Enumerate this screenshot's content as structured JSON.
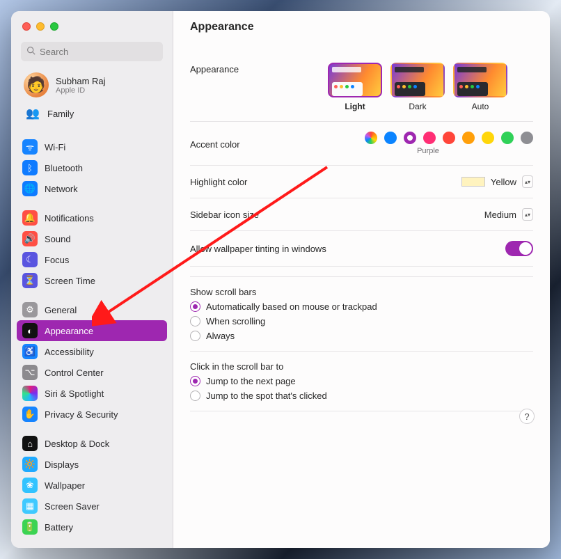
{
  "search": {
    "placeholder": "Search"
  },
  "user": {
    "name": "Subham Raj",
    "sub": "Apple ID"
  },
  "family": {
    "label": "Family"
  },
  "sidebar": {
    "items": [
      {
        "label": "Wi-Fi"
      },
      {
        "label": "Bluetooth"
      },
      {
        "label": "Network"
      },
      {
        "label": "Notifications"
      },
      {
        "label": "Sound"
      },
      {
        "label": "Focus"
      },
      {
        "label": "Screen Time"
      },
      {
        "label": "General"
      },
      {
        "label": "Appearance"
      },
      {
        "label": "Accessibility"
      },
      {
        "label": "Control Center"
      },
      {
        "label": "Siri & Spotlight"
      },
      {
        "label": "Privacy & Security"
      },
      {
        "label": "Desktop & Dock"
      },
      {
        "label": "Displays"
      },
      {
        "label": "Wallpaper"
      },
      {
        "label": "Screen Saver"
      },
      {
        "label": "Battery"
      }
    ]
  },
  "page": {
    "title": "Appearance"
  },
  "appearance": {
    "label": "Appearance",
    "options": [
      {
        "label": "Light",
        "selected": true,
        "dark": false
      },
      {
        "label": "Dark",
        "selected": false,
        "dark": true
      },
      {
        "label": "Auto",
        "selected": false,
        "dark": true
      }
    ]
  },
  "accent": {
    "label": "Accent color",
    "selected_label": "Purple",
    "colors": [
      "multicolor",
      "#0b84ff",
      "#9e27b0",
      "#ff2e74",
      "#ff453a",
      "#ff9f0a",
      "#ffd60a",
      "#30d158",
      "#8e8e93"
    ],
    "selected_index": 2
  },
  "highlight": {
    "label": "Highlight color",
    "value": "Yellow",
    "swatch": "#fff3bf"
  },
  "sidebar_size": {
    "label": "Sidebar icon size",
    "value": "Medium"
  },
  "tinting": {
    "label": "Allow wallpaper tinting in windows",
    "on": true
  },
  "scrollbars": {
    "heading": "Show scroll bars",
    "options": [
      "Automatically based on mouse or trackpad",
      "When scrolling",
      "Always"
    ],
    "selected": 0
  },
  "click": {
    "heading": "Click in the scroll bar to",
    "options": [
      "Jump to the next page",
      "Jump to the spot that's clicked"
    ],
    "selected": 0
  },
  "icons": {
    "wifi": "ᯤ",
    "bt": "ᛒ",
    "net": "🌐",
    "notif": "🔔",
    "sound": "🔊",
    "focus": "☾",
    "screen": "⏳",
    "general": "⚙",
    "app": "◐",
    "acc": "♿",
    "cc": "⌥",
    "siri": "✦",
    "priv": "✋",
    "desk": "⌂",
    "disp": "🔆",
    "wall": "❀",
    "ss": "▦",
    "batt": "🔋",
    "fam": "👥",
    "avatar": "🧑"
  }
}
